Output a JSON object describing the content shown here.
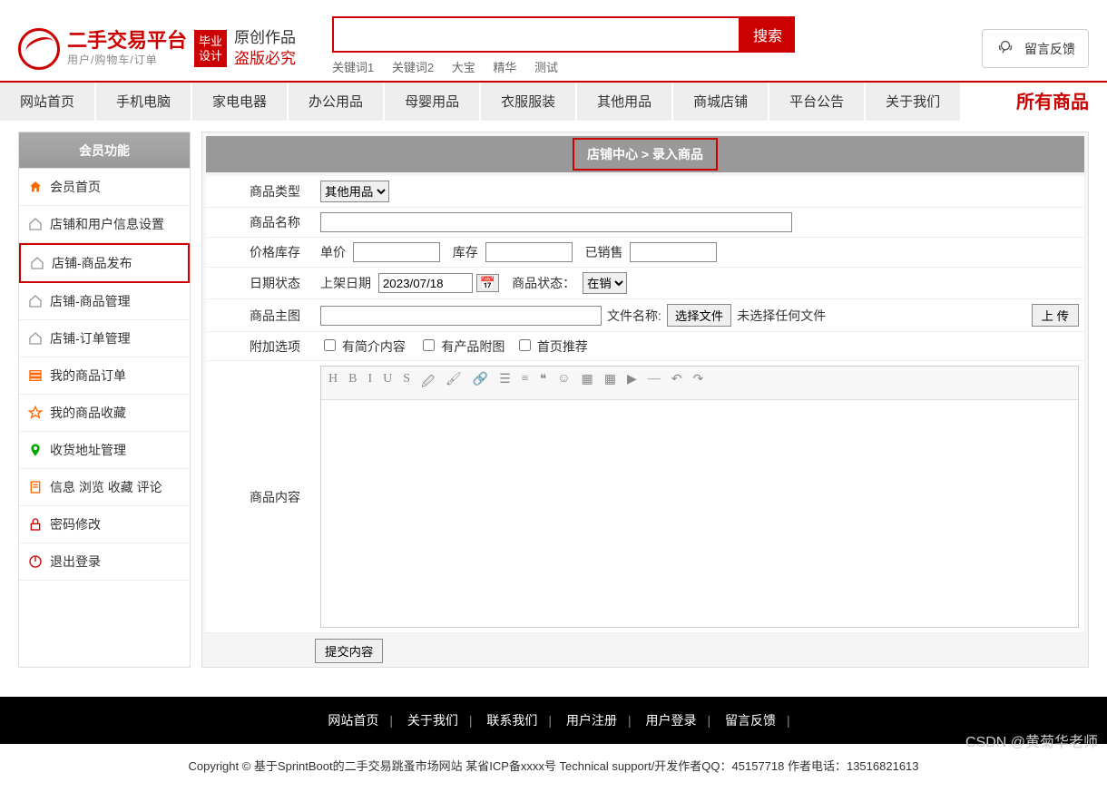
{
  "header": {
    "logo_title": "二手交易平台",
    "logo_sub": "用户/购物车/订单",
    "badge": "毕业设计",
    "slogan_l1": "原创作品",
    "slogan_l2": "盗版必究",
    "search_placeholder": "",
    "search_btn": "搜索",
    "keywords": [
      "关键词1",
      "关键词2",
      "大宝",
      "精华",
      "测试"
    ],
    "feedback": "留言反馈"
  },
  "nav": {
    "items": [
      "网站首页",
      "手机电脑",
      "家电电器",
      "办公用品",
      "母婴用品",
      "衣服服装",
      "其他用品",
      "商城店铺",
      "平台公告",
      "关于我们"
    ],
    "right": "所有商品"
  },
  "sidebar": {
    "head": "会员功能",
    "items": [
      {
        "label": "会员首页",
        "icon": "home-orange"
      },
      {
        "label": "店铺和用户信息设置",
        "icon": "home-gray"
      },
      {
        "label": "店铺-商品发布",
        "icon": "home-gray",
        "active": true
      },
      {
        "label": "店铺-商品管理",
        "icon": "home-gray"
      },
      {
        "label": "店铺-订单管理",
        "icon": "home-gray"
      },
      {
        "label": "我的商品订单",
        "icon": "list"
      },
      {
        "label": "我的商品收藏",
        "icon": "star"
      },
      {
        "label": "收货地址管理",
        "icon": "location"
      },
      {
        "label": "信息 浏览 收藏 评论",
        "icon": "doc"
      },
      {
        "label": "密码修改",
        "icon": "lock"
      },
      {
        "label": "退出登录",
        "icon": "power"
      }
    ]
  },
  "crumb": {
    "parent": "店铺中心",
    "sep": ">",
    "current": "录入商品"
  },
  "form": {
    "type_label": "商品类型",
    "type_value": "其他用品",
    "name_label": "商品名称",
    "name_value": "",
    "stock_label": "价格库存",
    "price_lbl": "单价",
    "price_val": "",
    "stock_lbl": "库存",
    "stock_val": "",
    "sold_lbl": "已销售",
    "sold_val": "",
    "date_label": "日期状态",
    "date_lbl": "上架日期",
    "date_val": "2023/07/18",
    "status_lbl": "商品状态：",
    "status_val": "在销",
    "image_label": "商品主图",
    "file_name_lbl": "文件名称:",
    "choose_file": "选择文件",
    "no_file": "未选择任何文件",
    "upload": "上 传",
    "extra_label": "附加选项",
    "cb1": "有简介内容",
    "cb2": "有产品附图",
    "cb3": "首页推荐",
    "content_label": "商品内容",
    "submit": "提交内容"
  },
  "editor_icons": [
    "H",
    "B",
    "I",
    "U",
    "S",
    "🖉",
    "🖌",
    "🔗",
    "☰",
    "≡",
    "❝",
    "☺",
    "▦",
    "▦",
    "▶",
    "—",
    "↶",
    "↷"
  ],
  "footer": {
    "links": [
      "网站首页",
      "关于我们",
      "联系我们",
      "用户注册",
      "用户登录",
      "留言反馈"
    ]
  },
  "copyright": "Copyright © 基于SprintBoot的二手交易跳蚤市场网站    某省ICP备xxxx号    Technical support/开发作者QQ：45157718    作者电话：13516821613",
  "watermark": "CSDN @黄菊华老师"
}
